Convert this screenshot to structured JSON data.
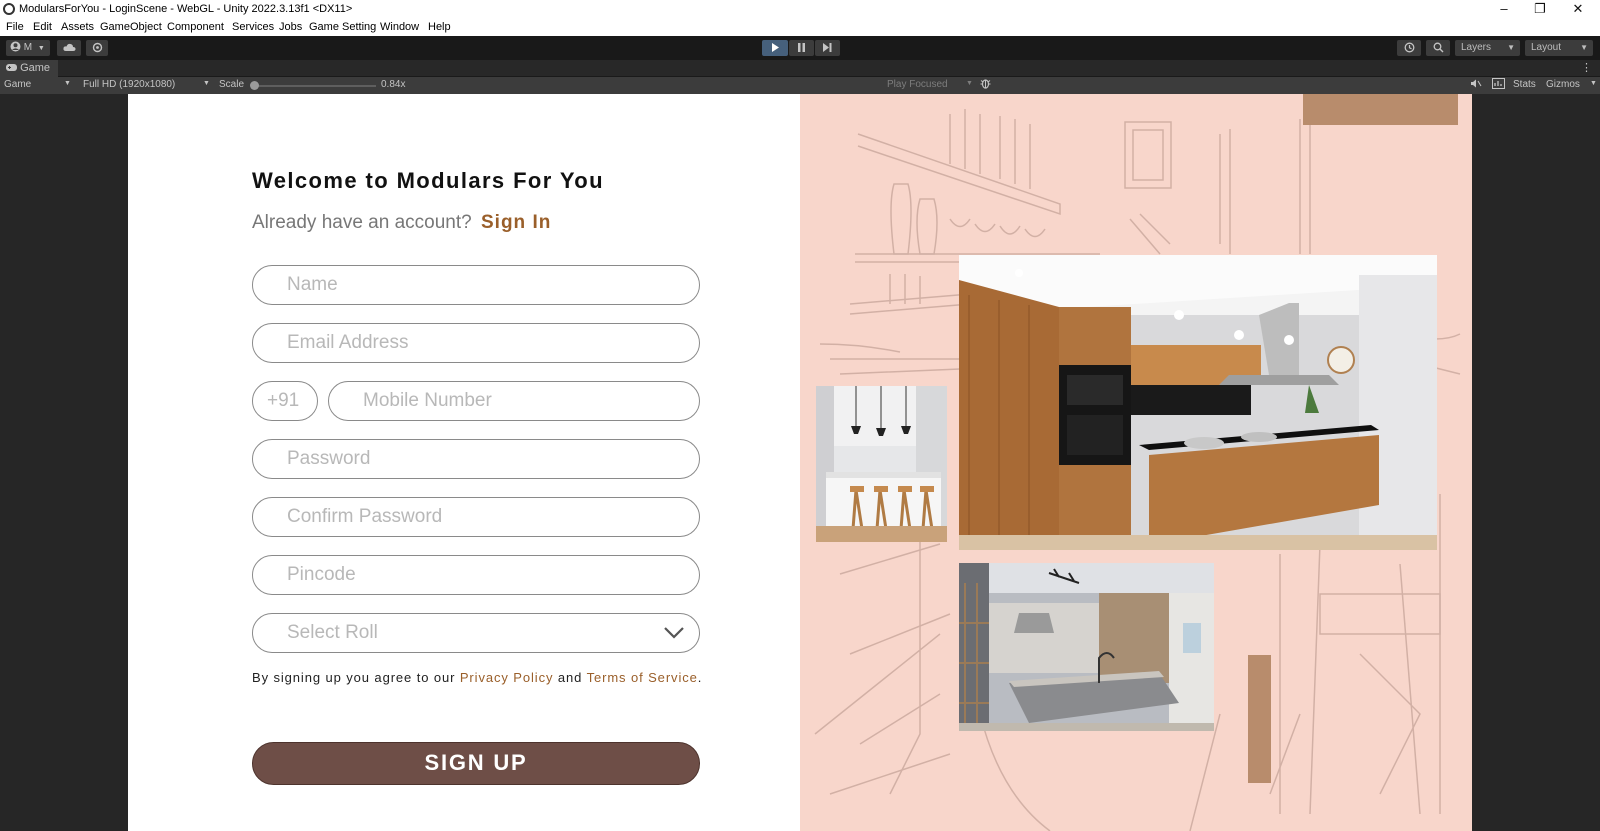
{
  "window": {
    "title": "ModularsForYou - LoginScene - WebGL - Unity 2022.3.13f1 <DX11>",
    "controls": {
      "minimize": "–",
      "restore": "❐",
      "close": "✕"
    }
  },
  "menu": [
    "File",
    "Edit",
    "Assets",
    "GameObject",
    "Component",
    "Services",
    "Jobs",
    "Game Setting",
    "Window",
    "Help"
  ],
  "toolbar": {
    "account_label": "M",
    "play_icon": "play-icon",
    "pause_icon": "pause-icon",
    "step_icon": "step-icon",
    "layers_label": "Layers",
    "layout_label": "Layout"
  },
  "game_tab": {
    "label": "Game"
  },
  "game_bar": {
    "display": "Game",
    "resolution": "Full HD (1920x1080)",
    "scale_label": "Scale",
    "scale_value": "0.84x",
    "play_mode": "Play Focused",
    "stats": "Stats",
    "gizmos": "Gizmos"
  },
  "form": {
    "welcome": "Welcome to Modulars For You",
    "account_prompt": "Already have an account?",
    "sign_in": "Sign In",
    "placeholders": {
      "name": "Name",
      "email": "Email Address",
      "country_code": "+91",
      "mobile": "Mobile Number",
      "password": "Password",
      "confirm_password": "Confirm Password",
      "pincode": "Pincode",
      "role": "Select Roll"
    },
    "terms_prefix": "By signing up you agree to our",
    "privacy_policy": "Privacy Policy",
    "terms_and": "and",
    "terms_of_service": "Terms of Service",
    "terms_suffix": ".",
    "signup_button": "SIGN UP"
  },
  "colors": {
    "accent": "#9a5f2a",
    "signup_bg": "#6e4e47",
    "panel_bg": "#f8d6cb",
    "deco_block": "#b88c6c"
  }
}
